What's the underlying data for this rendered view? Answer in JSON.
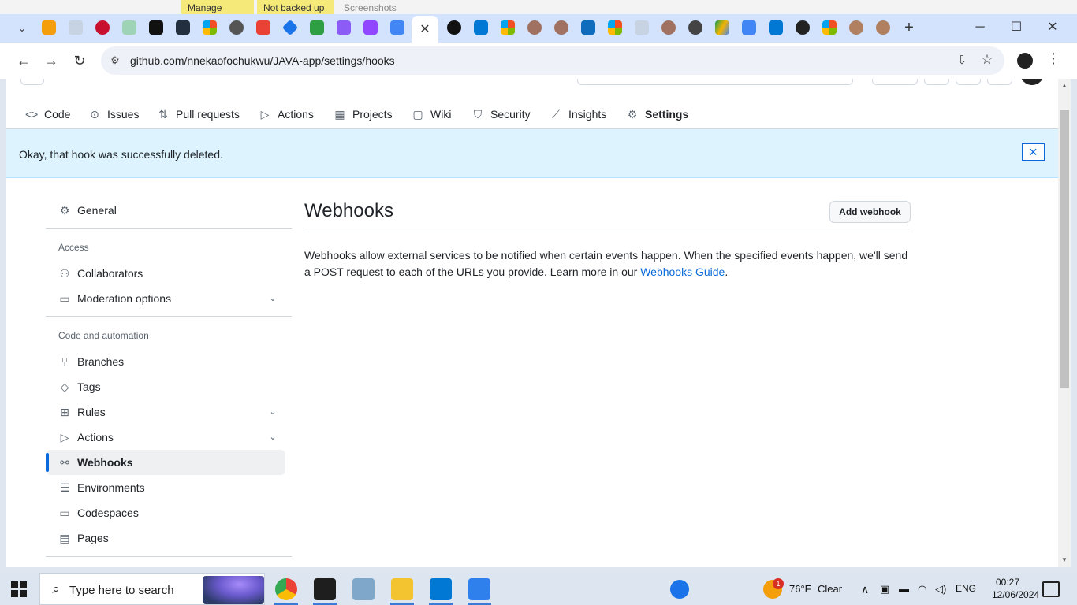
{
  "bg_window": {
    "manage_label": "Manage",
    "backup_label": "Not backed up",
    "screenshots_label": "Screenshots"
  },
  "browser": {
    "url": "github.com/nnekaofochukwu/JAVA-app/settings/hooks",
    "close_tab_glyph": "✕",
    "new_tab_glyph": "+",
    "minimize_glyph": "─",
    "maximize_glyph": "☐",
    "close_glyph": "✕"
  },
  "repo_nav": {
    "items": [
      {
        "label": "Code",
        "icon": "code-icon"
      },
      {
        "label": "Issues",
        "icon": "issue-icon"
      },
      {
        "label": "Pull requests",
        "icon": "pull-request-icon"
      },
      {
        "label": "Actions",
        "icon": "play-icon"
      },
      {
        "label": "Projects",
        "icon": "table-icon"
      },
      {
        "label": "Wiki",
        "icon": "book-icon"
      },
      {
        "label": "Security",
        "icon": "shield-icon"
      },
      {
        "label": "Insights",
        "icon": "graph-icon"
      },
      {
        "label": "Settings",
        "icon": "gear-icon",
        "selected": true
      }
    ]
  },
  "flash": {
    "message": "Okay, that hook was successfully deleted."
  },
  "sidebar": {
    "general": "General",
    "access_heading": "Access",
    "collaborators": "Collaborators",
    "moderation": "Moderation options",
    "code_heading": "Code and automation",
    "branches": "Branches",
    "tags": "Tags",
    "rules": "Rules",
    "actions": "Actions",
    "webhooks": "Webhooks",
    "environments": "Environments",
    "codespaces": "Codespaces",
    "pages": "Pages"
  },
  "main": {
    "title": "Webhooks",
    "add_button": "Add webhook",
    "desc_part1": "Webhooks allow external services to be notified when certain events happen. When the specified events happen, we'll send a POST request to each of the URLs you provide. Learn more in our ",
    "desc_link": "Webhooks Guide",
    "desc_part2": "."
  },
  "taskbar": {
    "search_placeholder": "Type here to search",
    "weather_temp": "76°F",
    "weather_cond": "Clear",
    "language": "ENG",
    "time": "00:27",
    "date": "12/06/2024",
    "weather_badge": "1"
  },
  "colors": {
    "accent": "#0969da",
    "flash_bg": "#ddf4ff",
    "selected_underline": "#fd8c73",
    "chrome_tabstrip": "#d3e3fd"
  }
}
